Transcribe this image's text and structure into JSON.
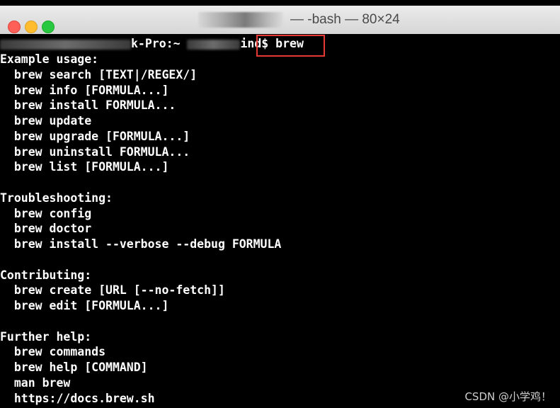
{
  "window": {
    "title_suffix": "— -bash — 80×24"
  },
  "prompt": {
    "host_suffix": "k-Pro:~",
    "user_suffix": "ind$",
    "command": "brew"
  },
  "output": [
    "Example usage:",
    "  brew search [TEXT|/REGEX/]",
    "  brew info [FORMULA...]",
    "  brew install FORMULA...",
    "  brew update",
    "  brew upgrade [FORMULA...]",
    "  brew uninstall FORMULA...",
    "  brew list [FORMULA...]",
    "",
    "Troubleshooting:",
    "  brew config",
    "  brew doctor",
    "  brew install --verbose --debug FORMULA",
    "",
    "Contributing:",
    "  brew create [URL [--no-fetch]]",
    "  brew edit [FORMULA...]",
    "",
    "Further help:",
    "  brew commands",
    "  brew help [COMMAND]",
    "  man brew",
    "  https://docs.brew.sh"
  ],
  "watermark": "CSDN @小学鸡！",
  "colors": {
    "background": "#000000",
    "text": "#ffffff",
    "highlight_box": "#e53935"
  }
}
